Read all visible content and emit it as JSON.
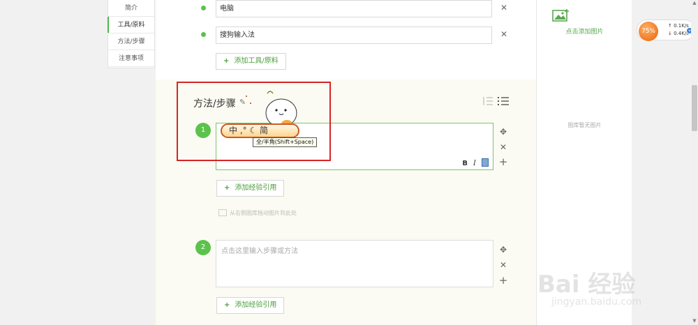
{
  "nav": {
    "items": [
      {
        "label": "简介"
      },
      {
        "label": "工具/原料"
      },
      {
        "label": "方法/步骤"
      },
      {
        "label": "注意事项"
      }
    ]
  },
  "tools": {
    "items": [
      "电脑",
      "搜狗输入法"
    ],
    "add_label": "添加工具/原料"
  },
  "steps": {
    "title": "方法/步骤",
    "list": [
      {
        "num": "1",
        "placeholder": "",
        "quote_label": "添加经验引用"
      },
      {
        "num": "2",
        "placeholder": "点击这里输入步骤或方法",
        "quote_label": "添加经验引用"
      }
    ],
    "drag_hint": "从右侧图库拖动图片到此处",
    "format": {
      "bold": "B",
      "italic": "I"
    }
  },
  "ime": {
    "bar_text": "中 ,° ☾ 简",
    "tooltip": "全/半角(Shift+Space)"
  },
  "right_panel": {
    "add_pic_label": "点击添加图片",
    "empty_text": "图库暂无图片"
  },
  "net_widget": {
    "percent": "75%",
    "up": "0.1K/s",
    "down": "0.4K/s"
  },
  "watermark": {
    "main": "Bai 经验",
    "sub": "jingyan.baidu.com"
  },
  "colors": {
    "accent": "#5cc24c",
    "highlight_box": "#d42525"
  },
  "icons": {
    "close": "close-icon",
    "move": "move-icon",
    "add": "add-icon",
    "pencil": "pencil-icon"
  }
}
